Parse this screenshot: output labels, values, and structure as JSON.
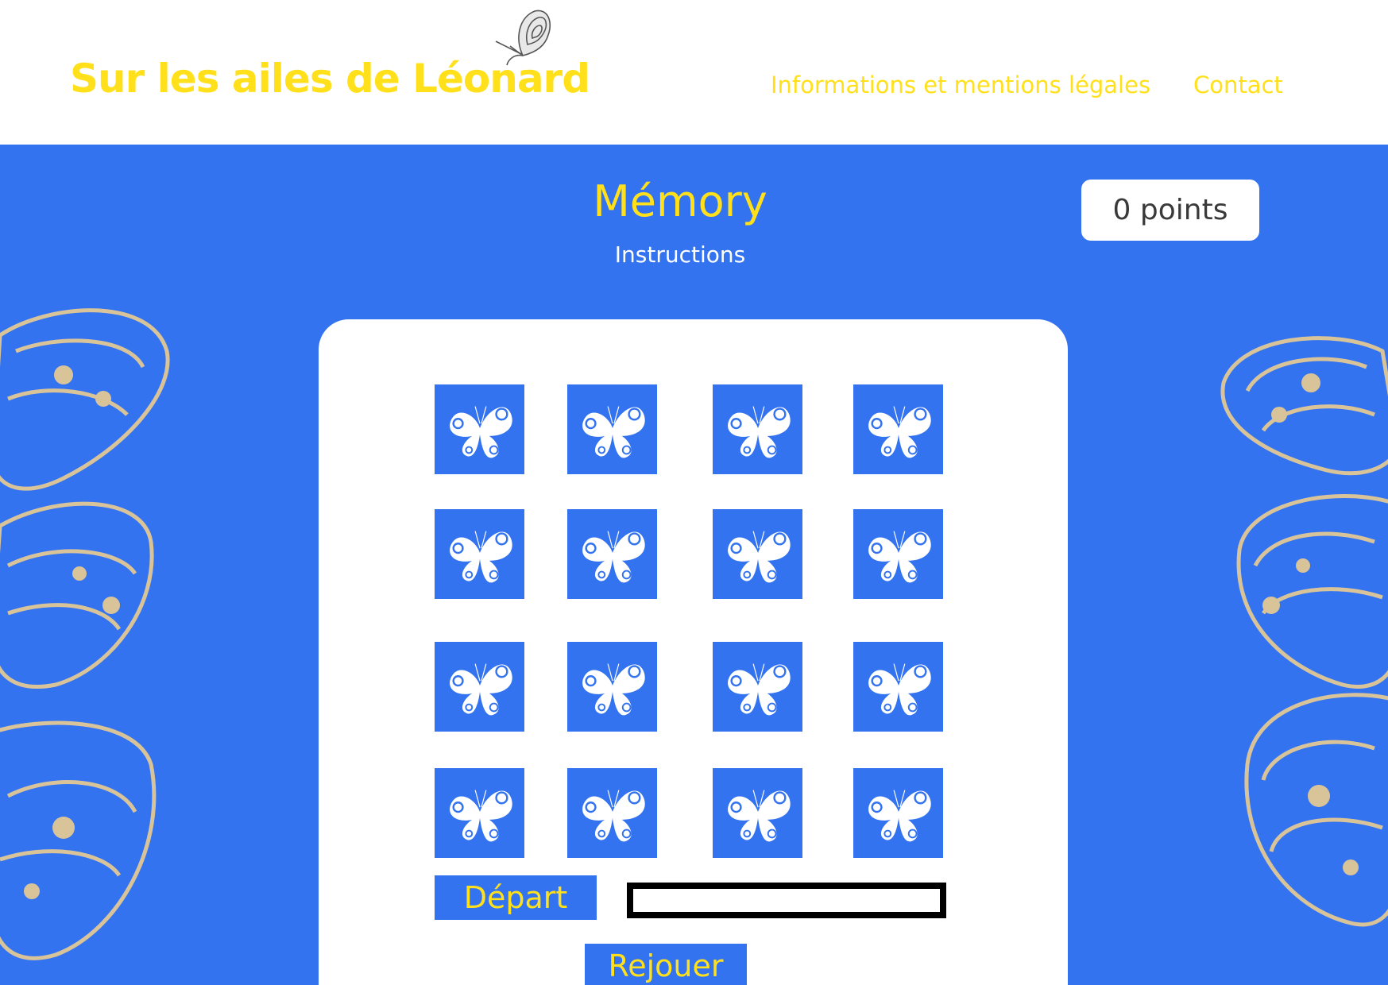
{
  "header": {
    "site_title": "Sur les ailes de Léonard",
    "nav": {
      "info": "Informations et mentions légales",
      "contact": "Contact"
    }
  },
  "game": {
    "title": "Mémory",
    "instructions": "Instructions",
    "score": "0 points",
    "cards": [
      {
        "state": "face-down",
        "icon": "butterfly-icon"
      },
      {
        "state": "face-down",
        "icon": "butterfly-icon"
      },
      {
        "state": "face-down",
        "icon": "butterfly-icon"
      },
      {
        "state": "face-down",
        "icon": "butterfly-icon"
      },
      {
        "state": "face-down",
        "icon": "butterfly-icon"
      },
      {
        "state": "face-down",
        "icon": "butterfly-icon"
      },
      {
        "state": "face-down",
        "icon": "butterfly-icon"
      },
      {
        "state": "face-down",
        "icon": "butterfly-icon"
      },
      {
        "state": "face-down",
        "icon": "butterfly-icon"
      },
      {
        "state": "face-down",
        "icon": "butterfly-icon"
      },
      {
        "state": "face-down",
        "icon": "butterfly-icon"
      },
      {
        "state": "face-down",
        "icon": "butterfly-icon"
      },
      {
        "state": "face-down",
        "icon": "butterfly-icon"
      },
      {
        "state": "face-down",
        "icon": "butterfly-icon"
      },
      {
        "state": "face-down",
        "icon": "butterfly-icon"
      },
      {
        "state": "face-down",
        "icon": "butterfly-icon"
      }
    ],
    "buttons": {
      "start": "Départ",
      "replay": "Rejouer"
    },
    "timer_progress": 0
  },
  "colors": {
    "accent_yellow": "#FFE01B",
    "primary_blue": "#3373F0",
    "wing_beige": "#D9C49A",
    "white": "#FFFFFF"
  }
}
